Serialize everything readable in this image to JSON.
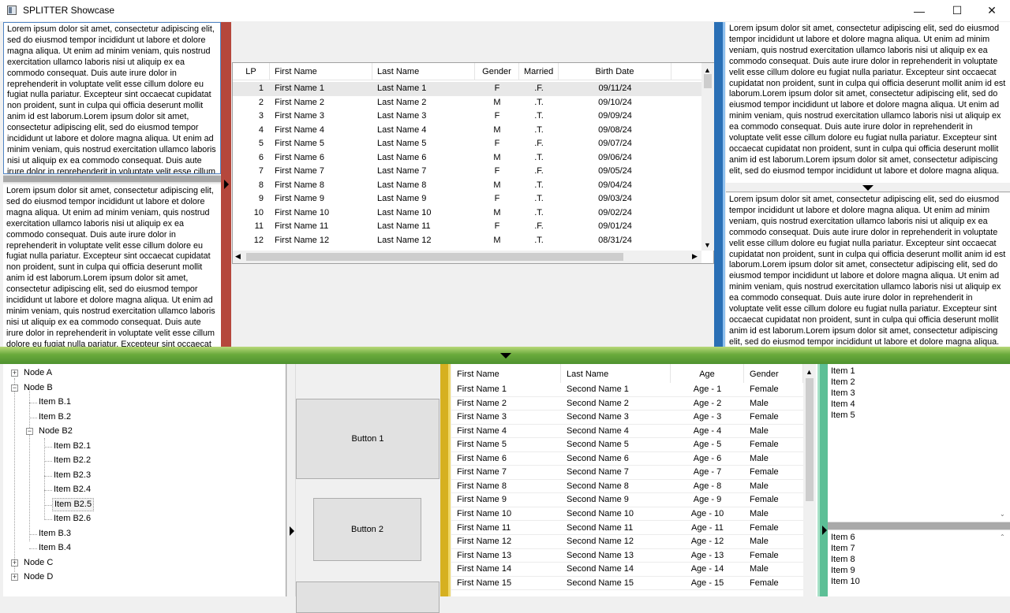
{
  "window": {
    "title": "SPLITTER Showcase",
    "minimize": "—",
    "maximize": "☐",
    "close": "✕"
  },
  "lorem": "Lorem ipsum dolor sit amet, consectetur adipiscing elit, sed do eiusmod tempor incididunt ut labore et dolore magna aliqua. Ut enim ad minim veniam, quis nostrud exercitation ullamco laboris nisi ut aliquip ex ea commodo consequat. Duis aute irure dolor in reprehenderit in voluptate velit esse cillum dolore eu fugiat nulla pariatur. Excepteur sint occaecat cupidatat non proident, sunt in culpa qui officia deserunt mollit anim id est laborum.Lorem ipsum dolor sit amet, consectetur adipiscing elit, sed do eiusmod tempor incididunt ut labore et dolore magna aliqua. Ut enim ad minim veniam, quis nostrud exercitation ullamco laboris nisi ut aliquip ex ea commodo consequat. Duis aute irure dolor in reprehenderit in voluptate velit esse cillum dolore eu fugiat nulla pariatur. Excepteur sint occaecat cupidatat non proident, sunt in culpa qui officia deserunt mollit anim id est laborum.Lorem ipsum dolor sit amet, consectetur adipiscing elit, sed do eiusmod tempor incididunt ut labore et dolore magna aliqua.",
  "colors": {
    "red_splitter": "#b5473c",
    "green_splitter": "#6aaa3c",
    "blue_splitter": "#2a6fb5",
    "yellow_splitter": "#d6b020",
    "teal_splitter": "#5cbf96"
  },
  "people_grid": {
    "columns": [
      "LP",
      "First Name",
      "Last Name",
      "Gender",
      "Married",
      "Birth Date"
    ],
    "rows": [
      [
        "1",
        "First Name 1",
        "Last Name 1",
        "F",
        ".F.",
        "09/11/24"
      ],
      [
        "2",
        "First Name 2",
        "Last Name 2",
        "M",
        ".T.",
        "09/10/24"
      ],
      [
        "3",
        "First Name 3",
        "Last Name 3",
        "F",
        ".T.",
        "09/09/24"
      ],
      [
        "4",
        "First Name 4",
        "Last Name 4",
        "M",
        ".T.",
        "09/08/24"
      ],
      [
        "5",
        "First Name 5",
        "Last Name 5",
        "F",
        ".F.",
        "09/07/24"
      ],
      [
        "6",
        "First Name 6",
        "Last Name 6",
        "M",
        ".T.",
        "09/06/24"
      ],
      [
        "7",
        "First Name 7",
        "Last Name 7",
        "F",
        ".F.",
        "09/05/24"
      ],
      [
        "8",
        "First Name 8",
        "Last Name 8",
        "M",
        ".T.",
        "09/04/24"
      ],
      [
        "9",
        "First Name 9",
        "Last Name 9",
        "F",
        ".T.",
        "09/03/24"
      ],
      [
        "10",
        "First Name 10",
        "Last Name 10",
        "M",
        ".T.",
        "09/02/24"
      ],
      [
        "11",
        "First Name 11",
        "Last Name 11",
        "F",
        ".F.",
        "09/01/24"
      ],
      [
        "12",
        "First Name 12",
        "Last Name 12",
        "M",
        ".T.",
        "08/31/24"
      ]
    ]
  },
  "tree": {
    "nodes": [
      {
        "label": "Node A",
        "level": 0,
        "toggle": "+"
      },
      {
        "label": "Node B",
        "level": 0,
        "toggle": "−"
      },
      {
        "label": "Item B.1",
        "level": 1,
        "toggle": ""
      },
      {
        "label": "Item B.2",
        "level": 1,
        "toggle": ""
      },
      {
        "label": "Node B2",
        "level": 1,
        "toggle": "−"
      },
      {
        "label": "Item B2.1",
        "level": 2,
        "toggle": ""
      },
      {
        "label": "Item B2.2",
        "level": 2,
        "toggle": ""
      },
      {
        "label": "Item B2.3",
        "level": 2,
        "toggle": ""
      },
      {
        "label": "Item B2.4",
        "level": 2,
        "toggle": ""
      },
      {
        "label": "Item B2.5",
        "level": 2,
        "toggle": "",
        "selected": true
      },
      {
        "label": "Item B2.6",
        "level": 2,
        "toggle": ""
      },
      {
        "label": "Item B.3",
        "level": 1,
        "toggle": ""
      },
      {
        "label": "Item B.4",
        "level": 1,
        "toggle": ""
      },
      {
        "label": "Node C",
        "level": 0,
        "toggle": "+"
      },
      {
        "label": "Node D",
        "level": 0,
        "toggle": "+"
      }
    ]
  },
  "buttons": {
    "button1": "Button 1",
    "button2": "Button 2"
  },
  "ages_grid": {
    "columns": [
      "First Name",
      "Last Name",
      "Age",
      "Gender"
    ],
    "rows": [
      [
        "First Name 1",
        "Second Name 1",
        "Age - 1",
        "Female"
      ],
      [
        "First Name 2",
        "Second Name 2",
        "Age - 2",
        "Male"
      ],
      [
        "First Name 3",
        "Second Name 3",
        "Age - 3",
        "Female"
      ],
      [
        "First Name 4",
        "Second Name 4",
        "Age - 4",
        "Male"
      ],
      [
        "First Name 5",
        "Second Name 5",
        "Age - 5",
        "Female"
      ],
      [
        "First Name 6",
        "Second Name 6",
        "Age - 6",
        "Male"
      ],
      [
        "First Name 7",
        "Second Name 7",
        "Age - 7",
        "Female"
      ],
      [
        "First Name 8",
        "Second Name 8",
        "Age - 8",
        "Male"
      ],
      [
        "First Name 9",
        "Second Name 9",
        "Age - 9",
        "Female"
      ],
      [
        "First Name 10",
        "Second Name 10",
        "Age - 10",
        "Male"
      ],
      [
        "First Name 11",
        "Second Name 11",
        "Age - 11",
        "Female"
      ],
      [
        "First Name 12",
        "Second Name 12",
        "Age - 12",
        "Male"
      ],
      [
        "First Name 13",
        "Second Name 13",
        "Age - 13",
        "Female"
      ],
      [
        "First Name 14",
        "Second Name 14",
        "Age - 14",
        "Male"
      ],
      [
        "First Name 15",
        "Second Name 15",
        "Age - 15",
        "Female"
      ]
    ]
  },
  "list_top": [
    "Item 1",
    "Item 2",
    "Item 3",
    "Item 4",
    "Item 5"
  ],
  "list_bottom": [
    "Item 6",
    "Item 7",
    "Item 8",
    "Item 9",
    "Item 10"
  ]
}
